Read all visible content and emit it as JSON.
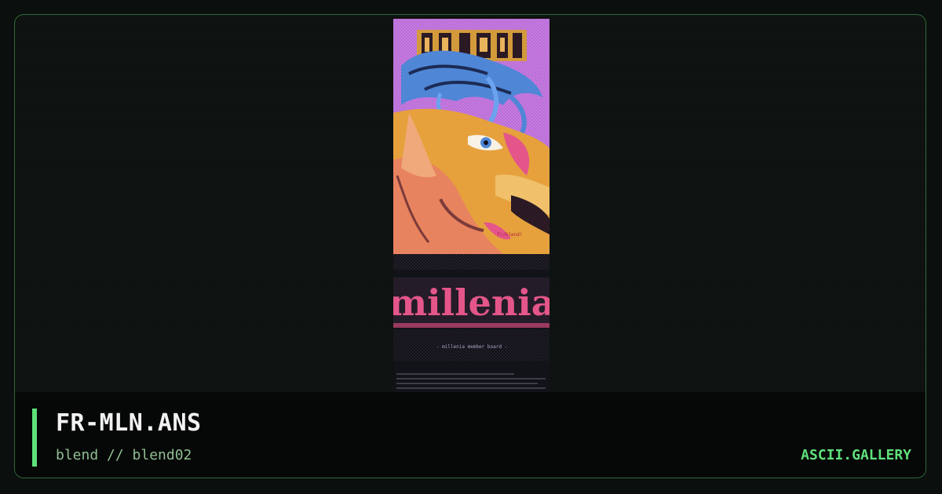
{
  "artwork": {
    "title_text": "millenia",
    "caption": "- millenia member board -",
    "signature": "fr/blend!"
  },
  "footer": {
    "title": "FR-MLN.ANS",
    "subtitle": "blend // blend02",
    "site": "ASCII.GALLERY"
  },
  "colors": {
    "accent": "#5fe07a",
    "border": "#2f6a36",
    "background": "#0d1110"
  }
}
